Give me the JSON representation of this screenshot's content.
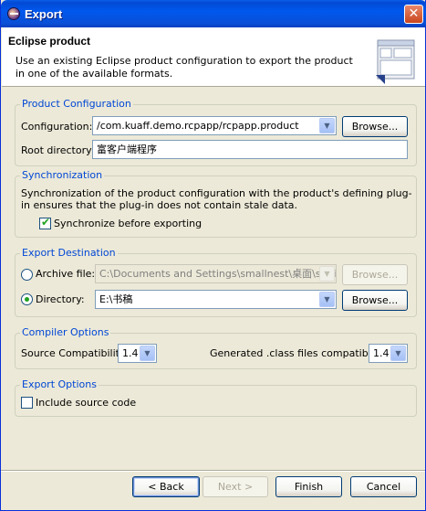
{
  "window": {
    "title": "Export",
    "close_glyph": "✕",
    "app_icon": "eclipse-icon"
  },
  "header": {
    "title": "Eclipse product",
    "description": "Use an existing Eclipse product configuration to export the product in one of the available formats."
  },
  "product_configuration": {
    "legend": "Product Configuration",
    "configuration_label": "Configuration:",
    "configuration_value": "/com.kuaff.demo.rcpapp/rcpapp.product",
    "browse_label": "Browse...",
    "root_directory_label": "Root directory:",
    "root_directory_value": "富客户端程序"
  },
  "synchronization": {
    "legend": "Synchronization",
    "description": "Synchronization of the product configuration with the product's defining plug-in ensures that the plug-in does not contain stale data.",
    "checkbox_label": "Synchronize before exporting",
    "checked": true
  },
  "export_destination": {
    "legend": "Export Destination",
    "archive_label": "Archive file:",
    "archive_value": "C:\\Documents and Settings\\smallnest\\桌面\\ss.zip",
    "archive_selected": false,
    "directory_label": "Directory:",
    "directory_value": "E:\\书稿",
    "directory_selected": true,
    "browse_label": "Browse..."
  },
  "compiler_options": {
    "legend": "Compiler Options",
    "source_label": "Source Compatibility:",
    "source_value": "1.4",
    "generated_label": "Generated .class files compatibility:",
    "generated_value": "1.4"
  },
  "export_options": {
    "legend": "Export Options",
    "include_source_label": "Include source code",
    "checked": false
  },
  "footer": {
    "back_label": "< Back",
    "next_label": "Next >",
    "finish_label": "Finish",
    "cancel_label": "Cancel"
  }
}
